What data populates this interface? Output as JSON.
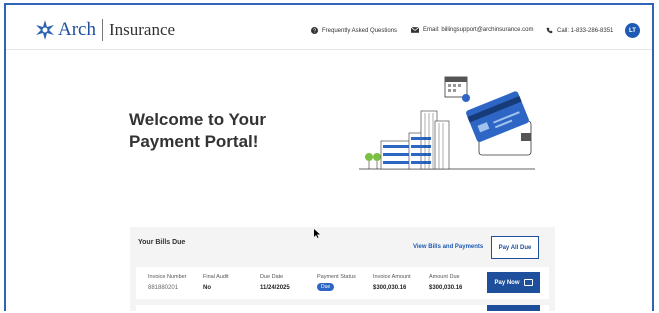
{
  "header": {
    "logo_brand": "Arch",
    "logo_suffix": "Insurance",
    "faq_label": "Frequently Asked Questions",
    "email_label": "Email: billingsupport@archinsurance.com",
    "call_label": "Call: 1-833-286-8351",
    "avatar_initials": "LT"
  },
  "hero": {
    "welcome_text": "Welcome to Your Payment Portal!"
  },
  "bills": {
    "title": "Your Bills Due",
    "view_link": "View Bills and Payments",
    "pay_all_label": "Pay All Due",
    "columns": [
      "Invoice Number",
      "Final Audit",
      "Due Date",
      "Payment Status",
      "Invoice Amount",
      "Amount Due"
    ],
    "rows": [
      {
        "invoice_number": "881880201",
        "final_audit": "No",
        "due_date": "11/24/2025",
        "status": "Due",
        "invoice_amount": "$300,030.16",
        "amount_due": "$300,030.16",
        "pay_label": "Pay Now"
      }
    ]
  },
  "colors": {
    "brand_blue": "#1e4f9c",
    "frame_border": "#2f63b6",
    "badge_blue": "#2d66c4"
  }
}
